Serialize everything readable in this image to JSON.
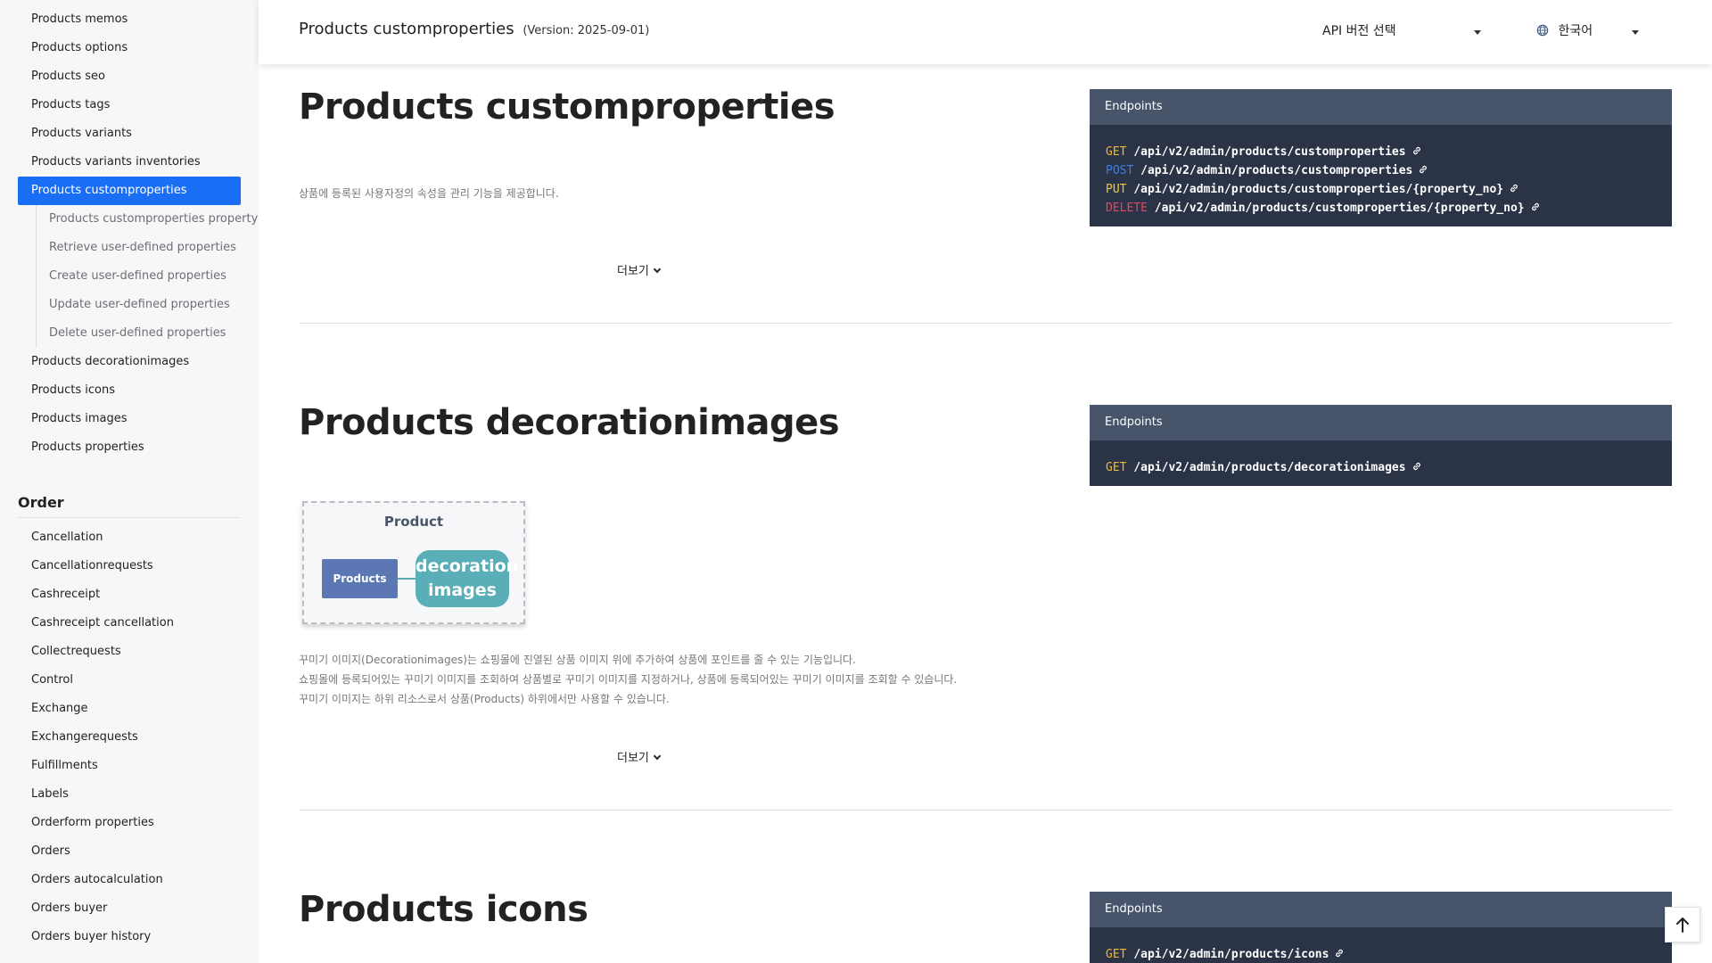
{
  "sidebar": {
    "products_items": [
      {
        "label": "Products memos"
      },
      {
        "label": "Products options"
      },
      {
        "label": "Products seo"
      },
      {
        "label": "Products tags"
      },
      {
        "label": "Products variants"
      },
      {
        "label": "Products variants inventories"
      }
    ],
    "active_item": "Products customproperties",
    "sub_items": [
      "Products customproperties property",
      "Retrieve user-defined properties",
      "Create user-defined properties",
      "Update user-defined properties",
      "Delete user-defined properties"
    ],
    "after_items": [
      "Products decorationimages",
      "Products icons",
      "Products images",
      "Products properties"
    ],
    "order_section": {
      "title": "Order",
      "items": [
        "Cancellation",
        "Cancellationrequests",
        "Cashreceipt",
        "Cashreceipt cancellation",
        "Collectrequests",
        "Control",
        "Exchange",
        "Exchangerequests",
        "Fulfillments",
        "Labels",
        "Orderform properties",
        "Orders",
        "Orders autocalculation",
        "Orders buyer",
        "Orders buyer history"
      ]
    }
  },
  "header": {
    "title": "Products customproperties",
    "version": "(Version: 2025-09-01)",
    "version_select": "API 버전 선택",
    "language_select": "한국어"
  },
  "sections": [
    {
      "title": "Products customproperties",
      "description": [
        "상품에 등록된 사용자정의 속성을 관리 기능을 제공합니다."
      ],
      "more": "더보기",
      "endpoints_label": "Endpoints",
      "endpoints": [
        {
          "method": "GET",
          "path": "/api/v2/admin/products/customproperties"
        },
        {
          "method": "POST",
          "path": "/api/v2/admin/products/customproperties"
        },
        {
          "method": "PUT",
          "path": "/api/v2/admin/products/customproperties/{property_no}"
        },
        {
          "method": "DELETE",
          "path": "/api/v2/admin/products/customproperties/{property_no}"
        }
      ]
    },
    {
      "title": "Products decorationimages",
      "diagram": {
        "title": "Product",
        "left_box": "Products",
        "right_box_line1": "decoration",
        "right_box_line2": "images"
      },
      "description": [
        "꾸미기 이미지(Decorationimages)는 쇼핑몰에 진열된 상품 이미지 위에 추가하여 상품에 포인트를 줄 수 있는 기능입니다.",
        "쇼핑몰에 등록되어있는 꾸미기 이미지를 조회하여 상품별로 꾸미기 이미지를 지정하거나, 상품에 등록되어있는 꾸미기 이미지를 조회할 수 있습니다.",
        "꾸미기 이미지는 하위 리소스로서 상품(Products) 하위에서만 사용할 수 있습니다."
      ],
      "more": "더보기",
      "endpoints_label": "Endpoints",
      "endpoints": [
        {
          "method": "GET",
          "path": "/api/v2/admin/products/decorationimages"
        }
      ]
    },
    {
      "title": "Products icons",
      "endpoints_label": "Endpoints",
      "endpoints": [
        {
          "method": "GET",
          "path": "/api/v2/admin/products/icons"
        }
      ]
    }
  ],
  "colors": {
    "accent": "#1a6ef5",
    "endpoint_bg": "#2a3446",
    "endpoint_header": "#47546a",
    "get": "#f0b63c",
    "post": "#3d7ef0",
    "put": "#e6c84a",
    "delete": "#e8455f"
  },
  "icons": [
    "globe-icon",
    "chevron-down-icon",
    "link-icon",
    "arrow-up-icon",
    "caret-down-icon"
  ]
}
